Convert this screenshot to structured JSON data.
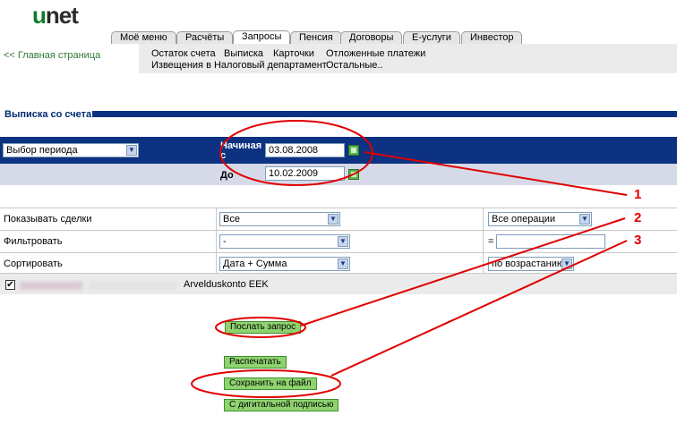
{
  "logo": {
    "u": "u",
    "net": "net"
  },
  "tabs": [
    {
      "label": "Моё меню",
      "active": false
    },
    {
      "label": "Расчёты",
      "active": false
    },
    {
      "label": "Запросы",
      "active": true
    },
    {
      "label": "Пенсия",
      "active": false
    },
    {
      "label": "Договоры",
      "active": false
    },
    {
      "label": "E-услуги",
      "active": false
    },
    {
      "label": "Инвестор",
      "active": false
    }
  ],
  "home_link": "<< Главная страница",
  "submenu": {
    "row1": [
      "Остаток счета",
      "Выписка",
      "Карточки",
      "Отложенные платежи"
    ],
    "row2": [
      "Извещения в Налоговый департамент",
      "Остальные.."
    ]
  },
  "section_title": "Выписка со счета",
  "period": {
    "select_value": "Выбор периода",
    "start_label_line1": "Начиная",
    "start_label_line2": "с",
    "start_date": "03.08.2008",
    "end_label": "До",
    "end_date": "10.02.2009"
  },
  "options": [
    {
      "label": "Показывать сделки",
      "value1": "Все",
      "value2": "Все операции"
    },
    {
      "label": "Фильтровать",
      "value1": "-",
      "value2_prefix": "=",
      "value2": ""
    },
    {
      "label": "Сортировать",
      "value1": "Дата + Сумма",
      "value2": "по возрастанию"
    }
  ],
  "account": {
    "checked": "✔",
    "name": "Arvelduskonto EEK"
  },
  "buttons": {
    "send_request": "Послать запрос",
    "print": "Распечатать",
    "save_file": "Сохранить на файл",
    "digital_signature": "С дигитальной подписью"
  },
  "annotations": [
    "1",
    "2",
    "3"
  ],
  "colors": {
    "accent_blue": "#0c3281",
    "brand_green": "#0a7a2a",
    "button_green": "#8fd36f",
    "annotation_red": "#e00000"
  }
}
